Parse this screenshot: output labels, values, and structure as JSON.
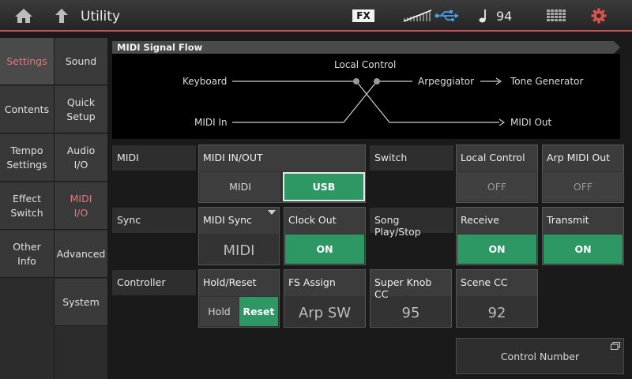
{
  "header": {
    "title": "Utility",
    "fx_badge": "FX",
    "tempo": "94",
    "accent_color": "#c8545a"
  },
  "sidebar": {
    "main": [
      {
        "label": "Settings",
        "active": true
      },
      {
        "label": "Contents",
        "active": false
      },
      {
        "label": "Tempo\nSettings",
        "active": false
      },
      {
        "label": "Effect\nSwitch",
        "active": false
      },
      {
        "label": "Other\nInfo",
        "active": false
      }
    ],
    "sub": [
      {
        "label": "Sound",
        "active": false
      },
      {
        "label": "Quick\nSetup",
        "active": false
      },
      {
        "label": "Audio\nI/O",
        "active": false
      },
      {
        "label": "MIDI\nI/O",
        "active": true
      },
      {
        "label": "Advanced",
        "active": false
      },
      {
        "label": "System",
        "active": false
      }
    ]
  },
  "signal_flow": {
    "title": "MIDI Signal Flow",
    "keyboard": "Keyboard",
    "local_control": "Local Control",
    "arpeggiator": "Arpeggiator",
    "tone_generator": "Tone Generator",
    "midi_in": "MIDI In",
    "midi_out": "MIDI Out"
  },
  "sections": {
    "midi": "MIDI",
    "switch": "Switch",
    "sync": "Sync",
    "song_play_stop": "Song Play/Stop",
    "controller": "Controller"
  },
  "midi_io": {
    "title": "MIDI IN/OUT",
    "options": [
      "MIDI",
      "USB"
    ],
    "selected": "USB"
  },
  "local_control": {
    "title": "Local Control",
    "value": "OFF"
  },
  "arp_midi_out": {
    "title": "Arp MIDI Out",
    "value": "OFF"
  },
  "midi_sync": {
    "title": "MIDI Sync",
    "value": "MIDI"
  },
  "clock_out": {
    "title": "Clock Out",
    "value": "ON"
  },
  "receive": {
    "title": "Receive",
    "value": "ON"
  },
  "transmit": {
    "title": "Transmit",
    "value": "ON"
  },
  "hold_reset": {
    "title": "Hold/Reset",
    "options": [
      "Hold",
      "Reset"
    ],
    "selected": "Reset"
  },
  "fs_assign": {
    "title": "FS Assign",
    "value": "Arp SW"
  },
  "super_knob_cc": {
    "title": "Super Knob CC",
    "value": "95"
  },
  "scene_cc": {
    "title": "Scene CC",
    "value": "92"
  },
  "control_number": {
    "label": "Control Number"
  },
  "colors": {
    "on": "#2e9864",
    "active_text": "#e8767c"
  }
}
